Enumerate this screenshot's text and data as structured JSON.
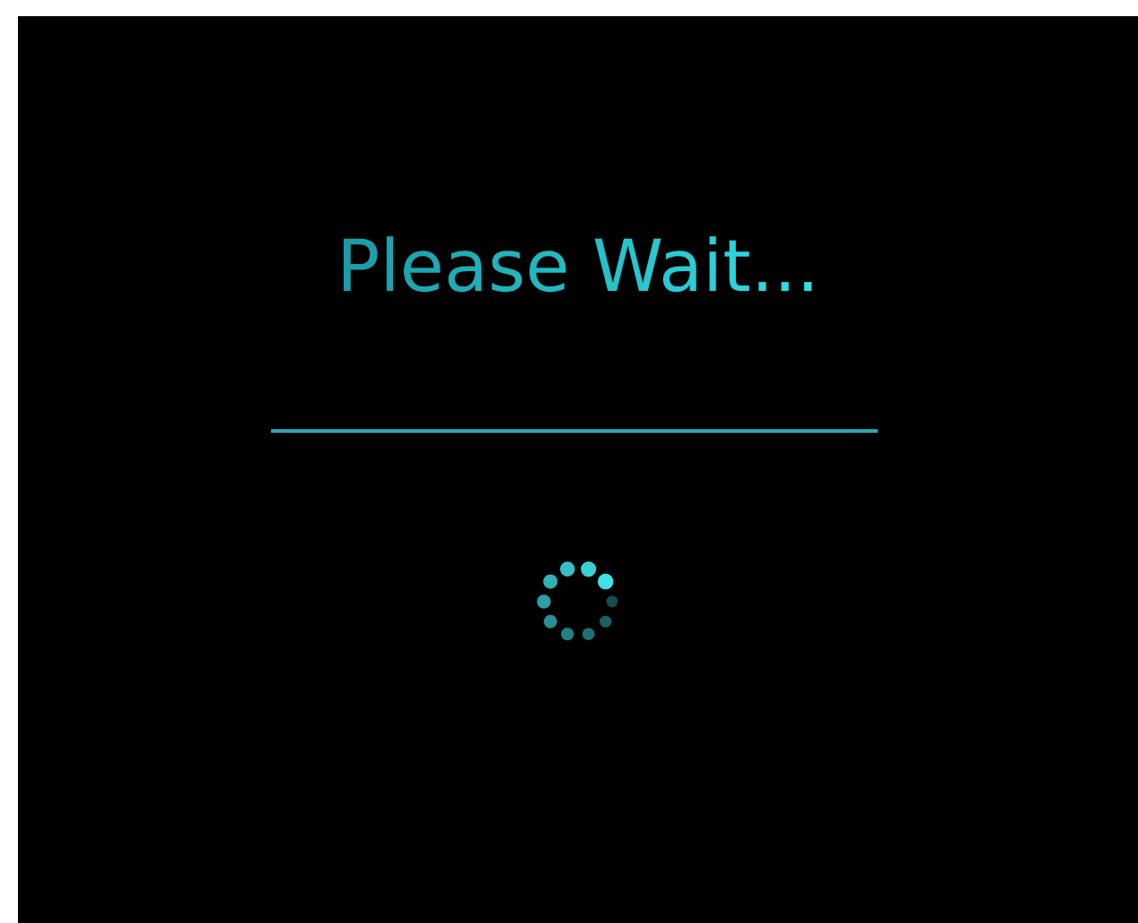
{
  "title": "Please Wait..."
}
